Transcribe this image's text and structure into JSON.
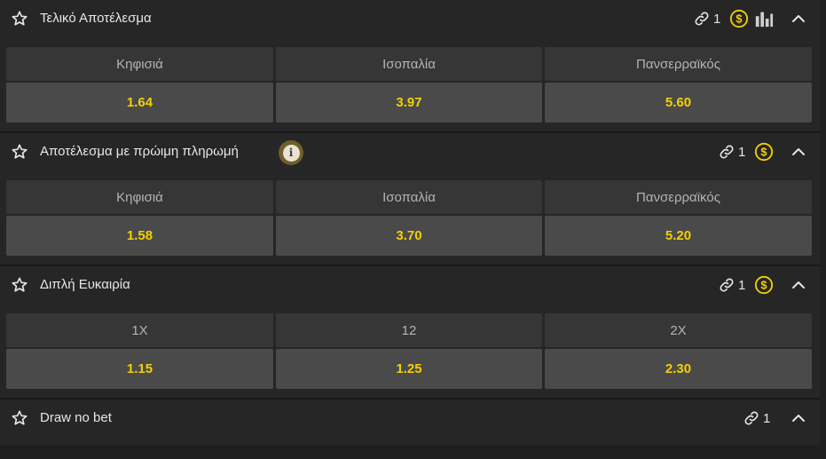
{
  "colors": {
    "accent": "#f3d000",
    "panel": "#262626",
    "cell_label_bg": "#363636",
    "cell_odd_bg": "#4a4a4a",
    "text": "#e6e6e6",
    "muted": "#b3b3b3"
  },
  "markets": [
    {
      "title": "Τελικό Αποτέλεσμα",
      "link_count": "1",
      "has_coin": true,
      "has_stats": true,
      "labels": [
        "Κηφισιά",
        "Ισοπαλία",
        "Πανσερραϊκός"
      ],
      "odds": [
        "1.64",
        "3.97",
        "5.60"
      ]
    },
    {
      "title": "Αποτέλεσμα με πρώιμη πληρωμή",
      "info_icon": "i",
      "link_count": "1",
      "has_coin": true,
      "labels": [
        "Κηφισιά",
        "Ισοπαλία",
        "Πανσερραϊκός"
      ],
      "odds": [
        "1.58",
        "3.70",
        "5.20"
      ]
    },
    {
      "title": "Διπλή Ευκαιρία",
      "link_count": "1",
      "has_coin": true,
      "labels": [
        "1X",
        "12",
        "2X"
      ],
      "odds": [
        "1.15",
        "1.25",
        "2.30"
      ]
    },
    {
      "title": "Draw no bet",
      "link_count": "1"
    }
  ],
  "icons": {
    "favorite": "star-outline-icon",
    "link": "link-icon",
    "cashout": "dollar-coin-icon",
    "stats": "bar-chart-icon",
    "collapse": "chevron-up-icon",
    "info": "info-icon"
  }
}
